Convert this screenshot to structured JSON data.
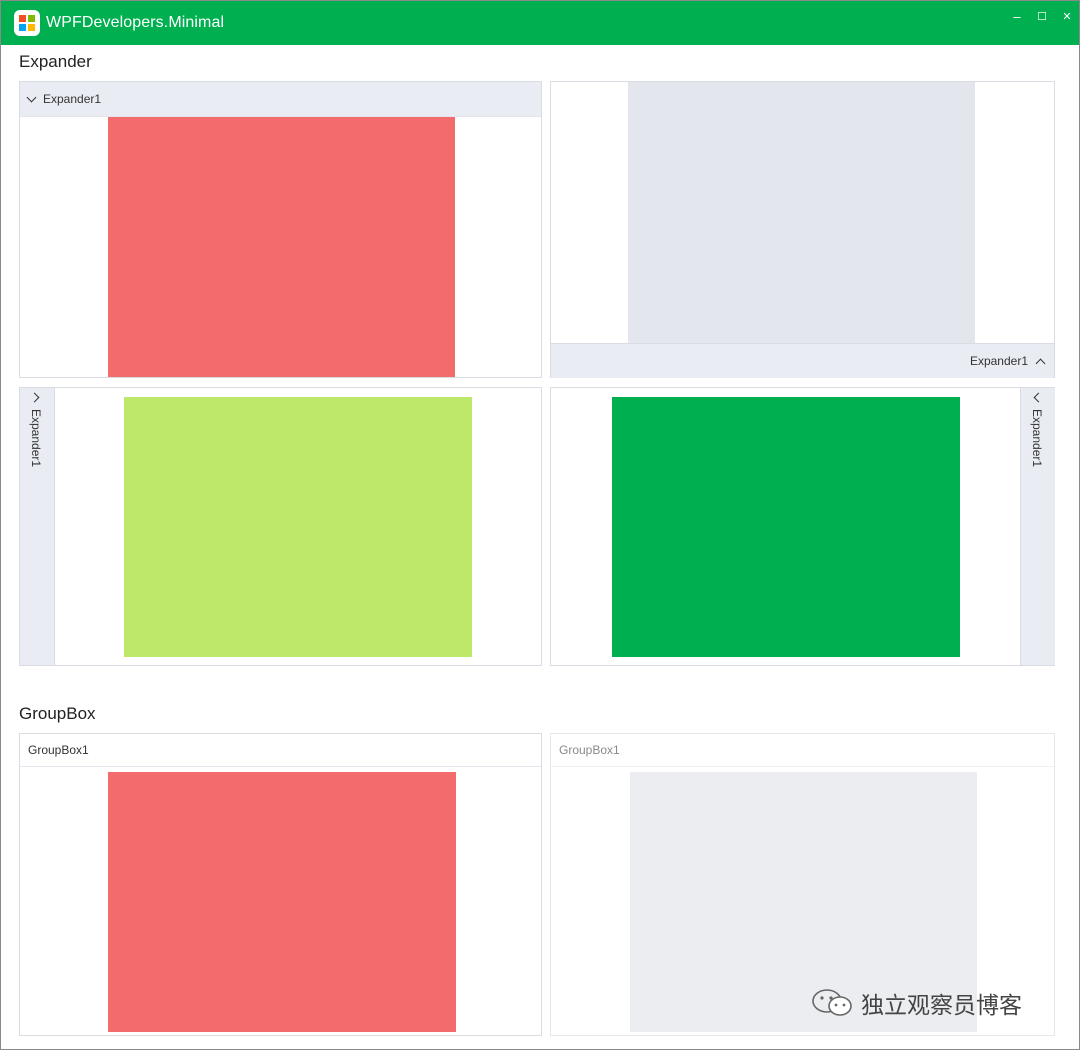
{
  "window": {
    "title": "WPFDevelopers.Minimal",
    "accent_color": "#00b050",
    "controls": {
      "minimize_icon": "–",
      "maximize_icon": "☐",
      "close_icon": "✕"
    }
  },
  "sections": {
    "expander": {
      "title": "Expander"
    },
    "groupbox": {
      "title": "GroupBox"
    }
  },
  "expanders": [
    {
      "header": "Expander1",
      "direction": "down",
      "expanded": true,
      "content_color": "#f46b6b"
    },
    {
      "header": "Expander1",
      "direction": "up",
      "expanded": true,
      "content_color": "#e3e6ed"
    },
    {
      "header": "Expander1",
      "direction": "right",
      "expanded": true,
      "content_color": "#bde869"
    },
    {
      "header": "Expander1",
      "direction": "left",
      "expanded": true,
      "content_color": "#00b050"
    }
  ],
  "groupboxes": [
    {
      "header": "GroupBox1",
      "enabled": true,
      "content_color": "#f46b6b"
    },
    {
      "header": "GroupBox1",
      "enabled": false,
      "content_color": "#ebedf1"
    }
  ],
  "watermark": {
    "text": "独立观察员博客",
    "icon": "wechat-icon"
  }
}
